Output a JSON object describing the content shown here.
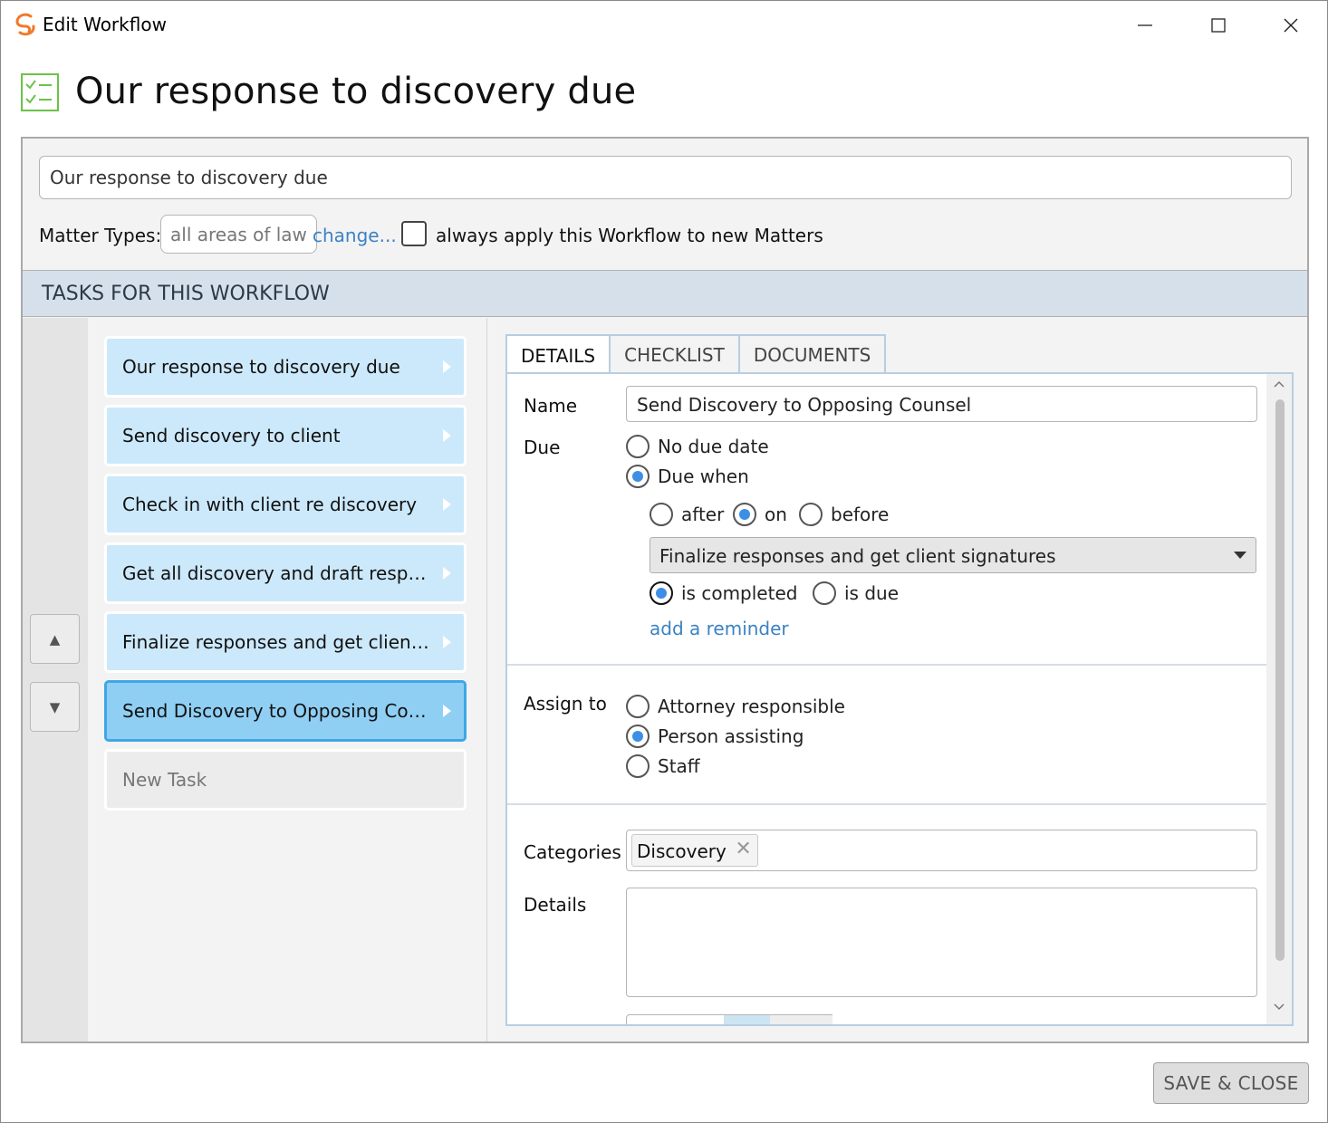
{
  "window": {
    "title": "Edit Workflow",
    "logo_icon": "sync-logo-icon",
    "controls": [
      "minimize-icon",
      "maximize-icon",
      "close-icon"
    ]
  },
  "header": {
    "icon": "checklist-icon",
    "title": "Our response to discovery due"
  },
  "workflow": {
    "name_value": "Our response to discovery due",
    "matter_types_label": "Matter Types:",
    "matter_types_value": "all areas of law",
    "change_link": "change...",
    "always_apply_checked": false,
    "always_apply_label": "always apply this Workflow to new Matters"
  },
  "tasks_section": {
    "heading": "TASKS FOR THIS WORKFLOW",
    "move_up_icon": "triangle-up-icon",
    "move_down_icon": "triangle-down-icon",
    "up_glyph": "▲",
    "down_glyph": "▼",
    "items": [
      {
        "label": "Our response to discovery due"
      },
      {
        "label": "Send discovery to client"
      },
      {
        "label": "Check in with client re discovery"
      },
      {
        "label": "Get all discovery and draft responses"
      },
      {
        "label": "Finalize responses and get client signatures"
      },
      {
        "label": "Send Discovery to Opposing Counsel",
        "selected": true
      }
    ],
    "new_task_label": "New Task"
  },
  "detail": {
    "tabs": [
      {
        "label": "DETAILS",
        "active": true
      },
      {
        "label": "CHECKLIST",
        "active": false
      },
      {
        "label": "DOCUMENTS",
        "active": false
      }
    ],
    "name_label": "Name",
    "name_value": "Send Discovery to Opposing Counsel",
    "due_label": "Due",
    "due_options": [
      "No due date",
      "Due when"
    ],
    "due_selected": "Due when",
    "relation_options": [
      "after",
      "on",
      "before"
    ],
    "relation_selected": "on",
    "related_task": "Finalize responses and get client signatures",
    "trigger_options": [
      "is completed",
      "is due"
    ],
    "trigger_selected": "is completed",
    "add_reminder_link": "add a reminder",
    "assign_label": "Assign to",
    "assign_options": [
      "Attorney responsible",
      "Person assisting",
      "Staff"
    ],
    "assign_selected": "Person assisting",
    "categories_label": "Categories",
    "categories": [
      "Discovery"
    ],
    "remove_glyph": "✕",
    "details_label": "Details",
    "details_value": ""
  },
  "footer": {
    "save_close_label": "SAVE & CLOSE"
  },
  "colors": {
    "accent_link": "#3b82c4",
    "task_item_bg": "#cce9fb",
    "task_selected_bg": "#90cff4",
    "task_selected_border": "#3fa7e6",
    "radio_on": "#3d8fe6",
    "tasks_header_bg": "#d6e0ea",
    "logo_orange": "#f07a2b",
    "checklist_green": "#6cc24a"
  }
}
